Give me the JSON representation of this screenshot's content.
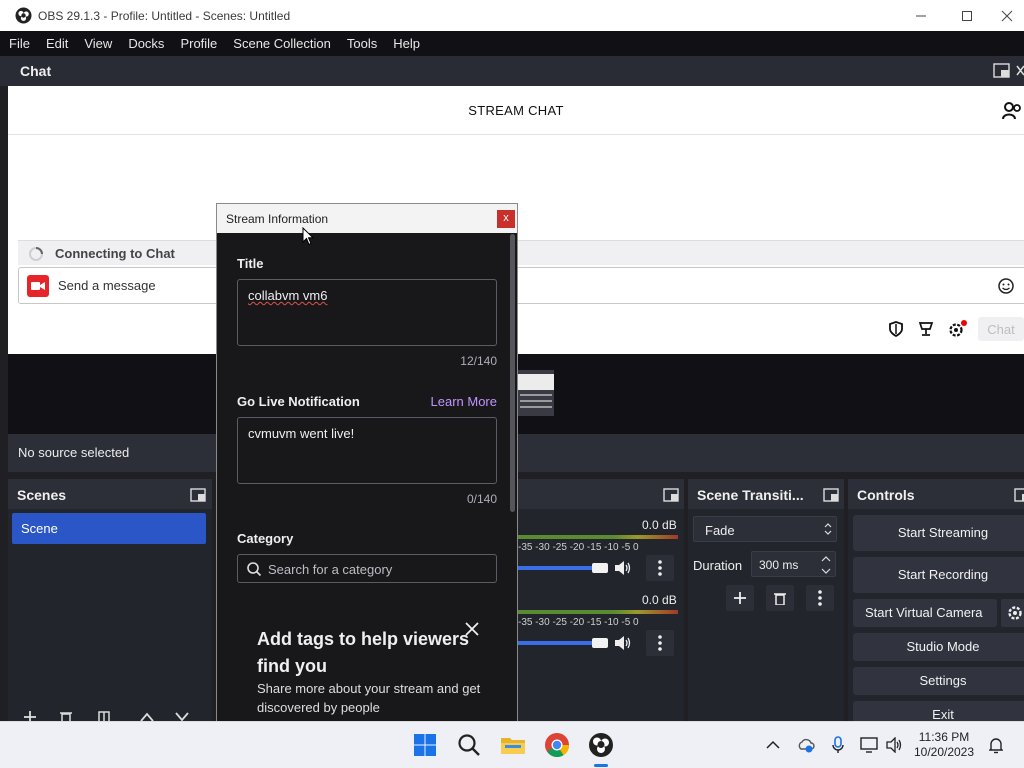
{
  "window": {
    "title": "OBS 29.1.3 - Profile: Untitled - Scenes: Untitled"
  },
  "menu": [
    "File",
    "Edit",
    "View",
    "Docks",
    "Profile",
    "Scene Collection",
    "Tools",
    "Help"
  ],
  "chat_dock": {
    "title": "Chat",
    "header": "STREAM CHAT",
    "connecting": "Connecting to Chat",
    "message_placeholder": "Send a message",
    "chat_button": "Chat"
  },
  "status": {
    "no_source": "No source selected"
  },
  "scenes_dock": {
    "title": "Scenes",
    "items": [
      "Scene"
    ]
  },
  "mixer": {
    "channels": [
      {
        "db": "0.0 dB",
        "ticks": "-35 -30 -25 -20 -15 -10 -5 0",
        "volume": 1.0
      },
      {
        "db": "0.0 dB",
        "ticks": "-35 -30 -25 -20 -15 -10 -5 0",
        "volume": 1.0
      }
    ]
  },
  "transitions_dock": {
    "title": "Scene Transiti...",
    "transition": "Fade",
    "duration_label": "Duration",
    "duration_value": "300 ms"
  },
  "controls_dock": {
    "title": "Controls",
    "buttons": [
      "Start Streaming",
      "Start Recording",
      "Start Virtual Camera",
      "Studio Mode",
      "Settings",
      "Exit"
    ]
  },
  "stream_info": {
    "title": "Stream Information",
    "close": "x",
    "title_label": "Title",
    "title_value": "collabvm vm6",
    "title_count": "12/140",
    "notification_label": "Go Live Notification",
    "learn_more": "Learn More",
    "notification_value": "cvmuvm went live!",
    "notification_count": "0/140",
    "category_label": "Category",
    "category_placeholder": "Search for a category",
    "tags_heading": "Add tags to help viewers find you",
    "tags_text": "Share more about your stream and get discovered by people"
  },
  "taskbar": {
    "time": "11:36 PM",
    "date": "10/20/2023"
  },
  "colors": {
    "accent_blue": "#2b56c8",
    "twitch_purple": "#bf94ff",
    "close_red": "#c9302c"
  }
}
